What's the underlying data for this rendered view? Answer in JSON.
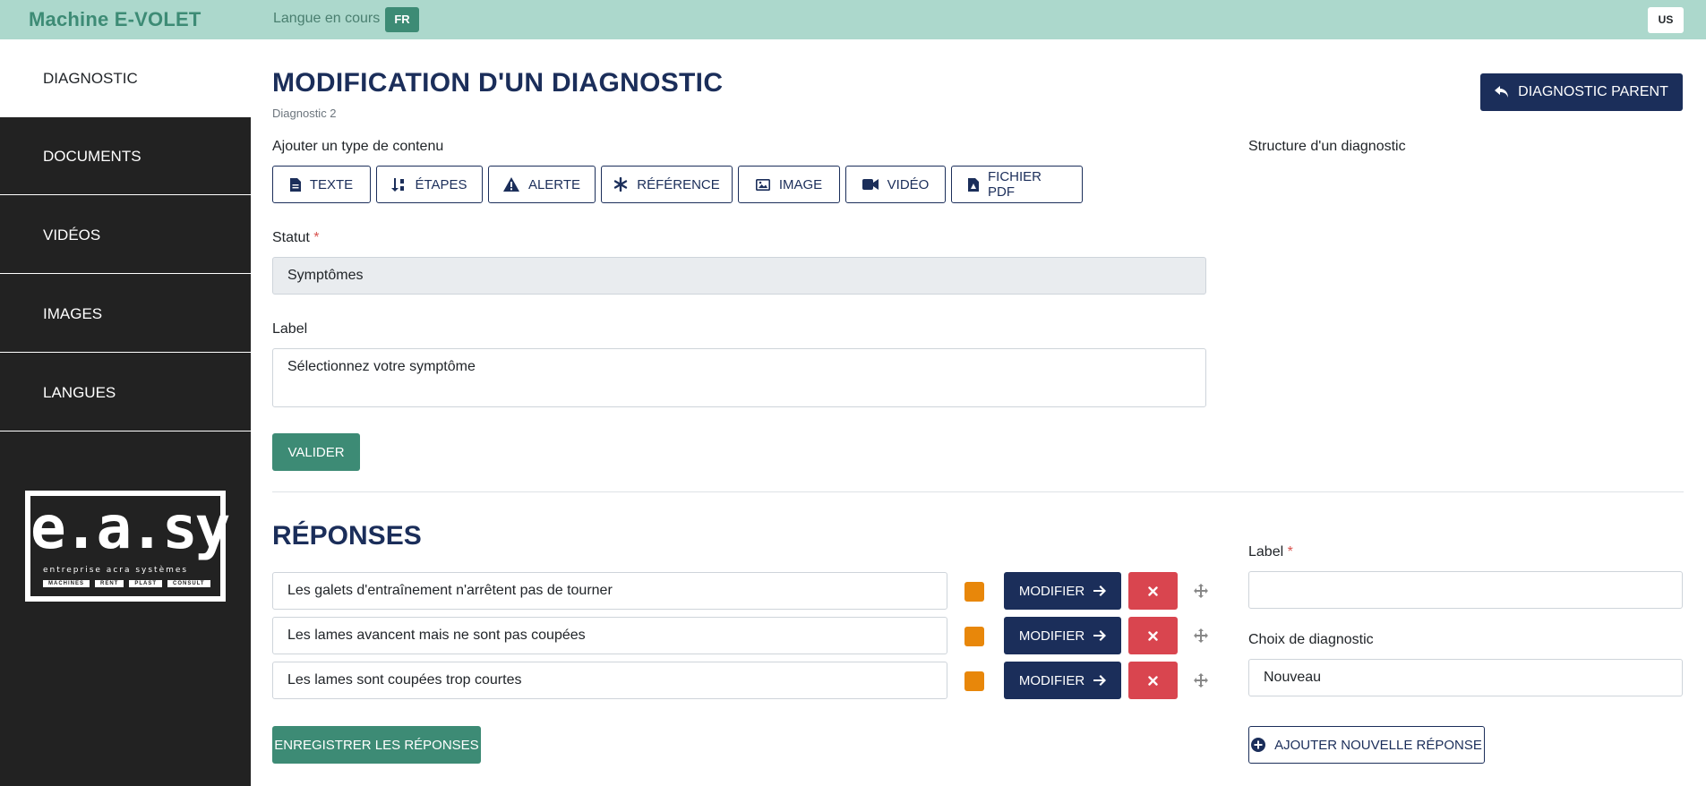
{
  "header": {
    "app_title": "Machine E-VOLET",
    "lang_label": "Langue en cours",
    "lang_current": "FR",
    "lang_switch": "US"
  },
  "sidebar": {
    "items": [
      {
        "label": "DIAGNOSTIC",
        "active": true
      },
      {
        "label": "DOCUMENTS",
        "active": false
      },
      {
        "label": "VIDÉOS",
        "active": false
      },
      {
        "label": "IMAGES",
        "active": false
      },
      {
        "label": "LANGUES",
        "active": false
      }
    ],
    "logo": {
      "text": "e.a.sy",
      "subtitle": "entreprise acra systèmes",
      "tags": [
        "MACHINES",
        "RENT",
        "PLAST",
        "CONSULT"
      ]
    }
  },
  "main": {
    "title": "MODIFICATION D'UN DIAGNOSTIC",
    "subtitle": "Diagnostic 2",
    "parent_button": "DIAGNOSTIC PARENT",
    "add_content_label": "Ajouter un type de contenu",
    "structure_label": "Structure d'un diagnostic",
    "content_types": [
      {
        "label": "TEXTE",
        "icon": "file-text-icon"
      },
      {
        "label": "ÉTAPES",
        "icon": "sort-steps-icon"
      },
      {
        "label": "ALERTE",
        "icon": "warning-icon"
      },
      {
        "label": "RÉFÉRENCE",
        "icon": "asterisk-icon"
      },
      {
        "label": "IMAGE",
        "icon": "image-icon"
      },
      {
        "label": "VIDÉO",
        "icon": "video-icon"
      },
      {
        "label": "FICHIER PDF",
        "icon": "pdf-file-icon"
      }
    ],
    "statut_label": "Statut",
    "statut_value": "Symptômes",
    "label_label": "Label",
    "label_value": "Sélectionnez votre symptôme",
    "validate_button": "VALIDER"
  },
  "responses": {
    "title": "RÉPONSES",
    "modify_label": "MODIFIER",
    "items": [
      {
        "text": "Les galets d'entraînement n'arrêtent pas de tourner",
        "color": "#e8870a"
      },
      {
        "text": "Les lames avancent mais ne sont pas coupées",
        "color": "#e8870a"
      },
      {
        "text": "Les lames sont coupées trop courtes",
        "color": "#e8870a"
      }
    ],
    "save_button": "ENREGISTRER LES RÉPONSES",
    "form": {
      "label_label": "Label",
      "label_value": "",
      "choice_label": "Choix de diagnostic",
      "choice_value": "Nouveau",
      "add_button": "AJOUTER NOUVELLE RÉPONSE"
    }
  },
  "colors": {
    "topbar": "#acd8cc",
    "brand": "#3d8b75",
    "navy": "#1b2e5a",
    "sidebar": "#222222",
    "danger": "#d9454f",
    "orange": "#e8870a"
  }
}
